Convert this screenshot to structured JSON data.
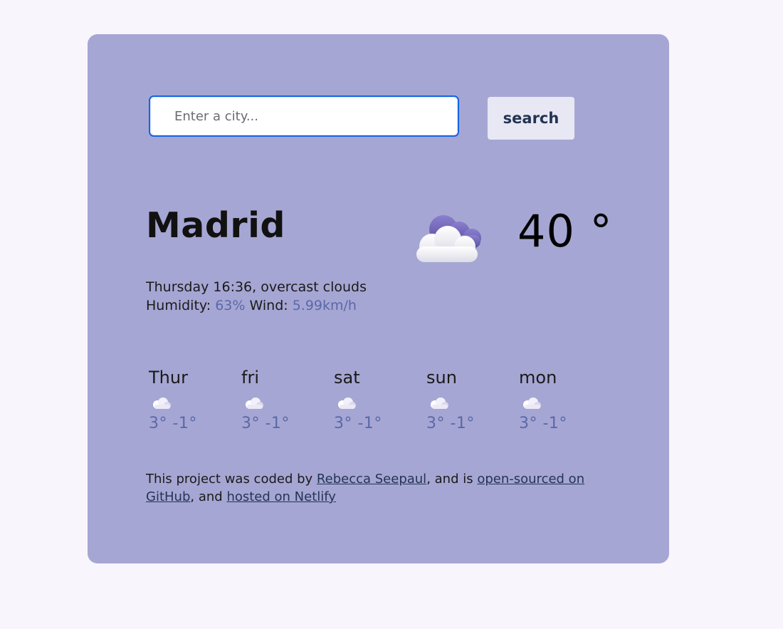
{
  "search": {
    "placeholder": "Enter a city...",
    "button_label": "search"
  },
  "current": {
    "city": "Madrid",
    "temperature": "40 °",
    "date_condition": "Thursday 16:36, overcast clouds",
    "humidity_label": "Humidity:",
    "humidity_value": "63%",
    "wind_label": "Wind:",
    "wind_value": "5.99km/h",
    "icon": "overcast-clouds-icon"
  },
  "forecast": [
    {
      "day": "Thur",
      "temps": "3° -1°",
      "icon": "cloud-icon"
    },
    {
      "day": "fri",
      "temps": "3° -1°",
      "icon": "cloud-icon"
    },
    {
      "day": "sat",
      "temps": "3° -1°",
      "icon": "cloud-icon"
    },
    {
      "day": "sun",
      "temps": "3° -1°",
      "icon": "cloud-icon"
    },
    {
      "day": "mon",
      "temps": "3° -1°",
      "icon": "cloud-icon"
    }
  ],
  "footer": {
    "text_1": "This project was coded by",
    "link_author": "Rebecca Seepaul",
    "text_2": ", and is",
    "link_source": "open-sourced on GitHub",
    "text_3": ", and",
    "link_hosting": "hosted on Netlify"
  },
  "colors": {
    "page_background": "#f9f5fd",
    "card_background": "#a6a6d4",
    "accent_text": "#5969a8",
    "input_border": "#1565e5",
    "button_background": "#e8e8f4"
  }
}
